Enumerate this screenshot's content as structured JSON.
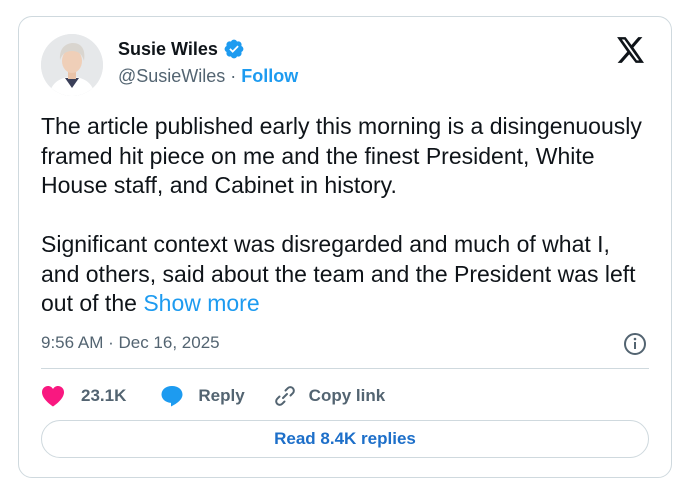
{
  "author": {
    "name": "Susie Wiles",
    "handle": "@SusieWiles",
    "separator": "·",
    "follow_label": "Follow",
    "verified_icon": "verified-badge-icon"
  },
  "tweet": {
    "paragraph_1": "The article published early this morning is a disingenuously framed hit piece on me and the finest President, White House staff, and Cabinet in history.",
    "paragraph_2": "Significant context was disregarded and much of what I, and others, said about the team and the President was left out of the ",
    "show_more_label": "Show more",
    "timestamp": "9:56 AM · Dec 16, 2025"
  },
  "actions": {
    "likes": "23.1K",
    "reply_label": "Reply",
    "copy_link_label": "Copy link",
    "read_replies_label": "Read 8.4K replies"
  },
  "colors": {
    "accent": "#1d9bf0",
    "like": "#f91880",
    "text": "#0f1419",
    "muted": "#536471",
    "border": "#cfd9de"
  }
}
